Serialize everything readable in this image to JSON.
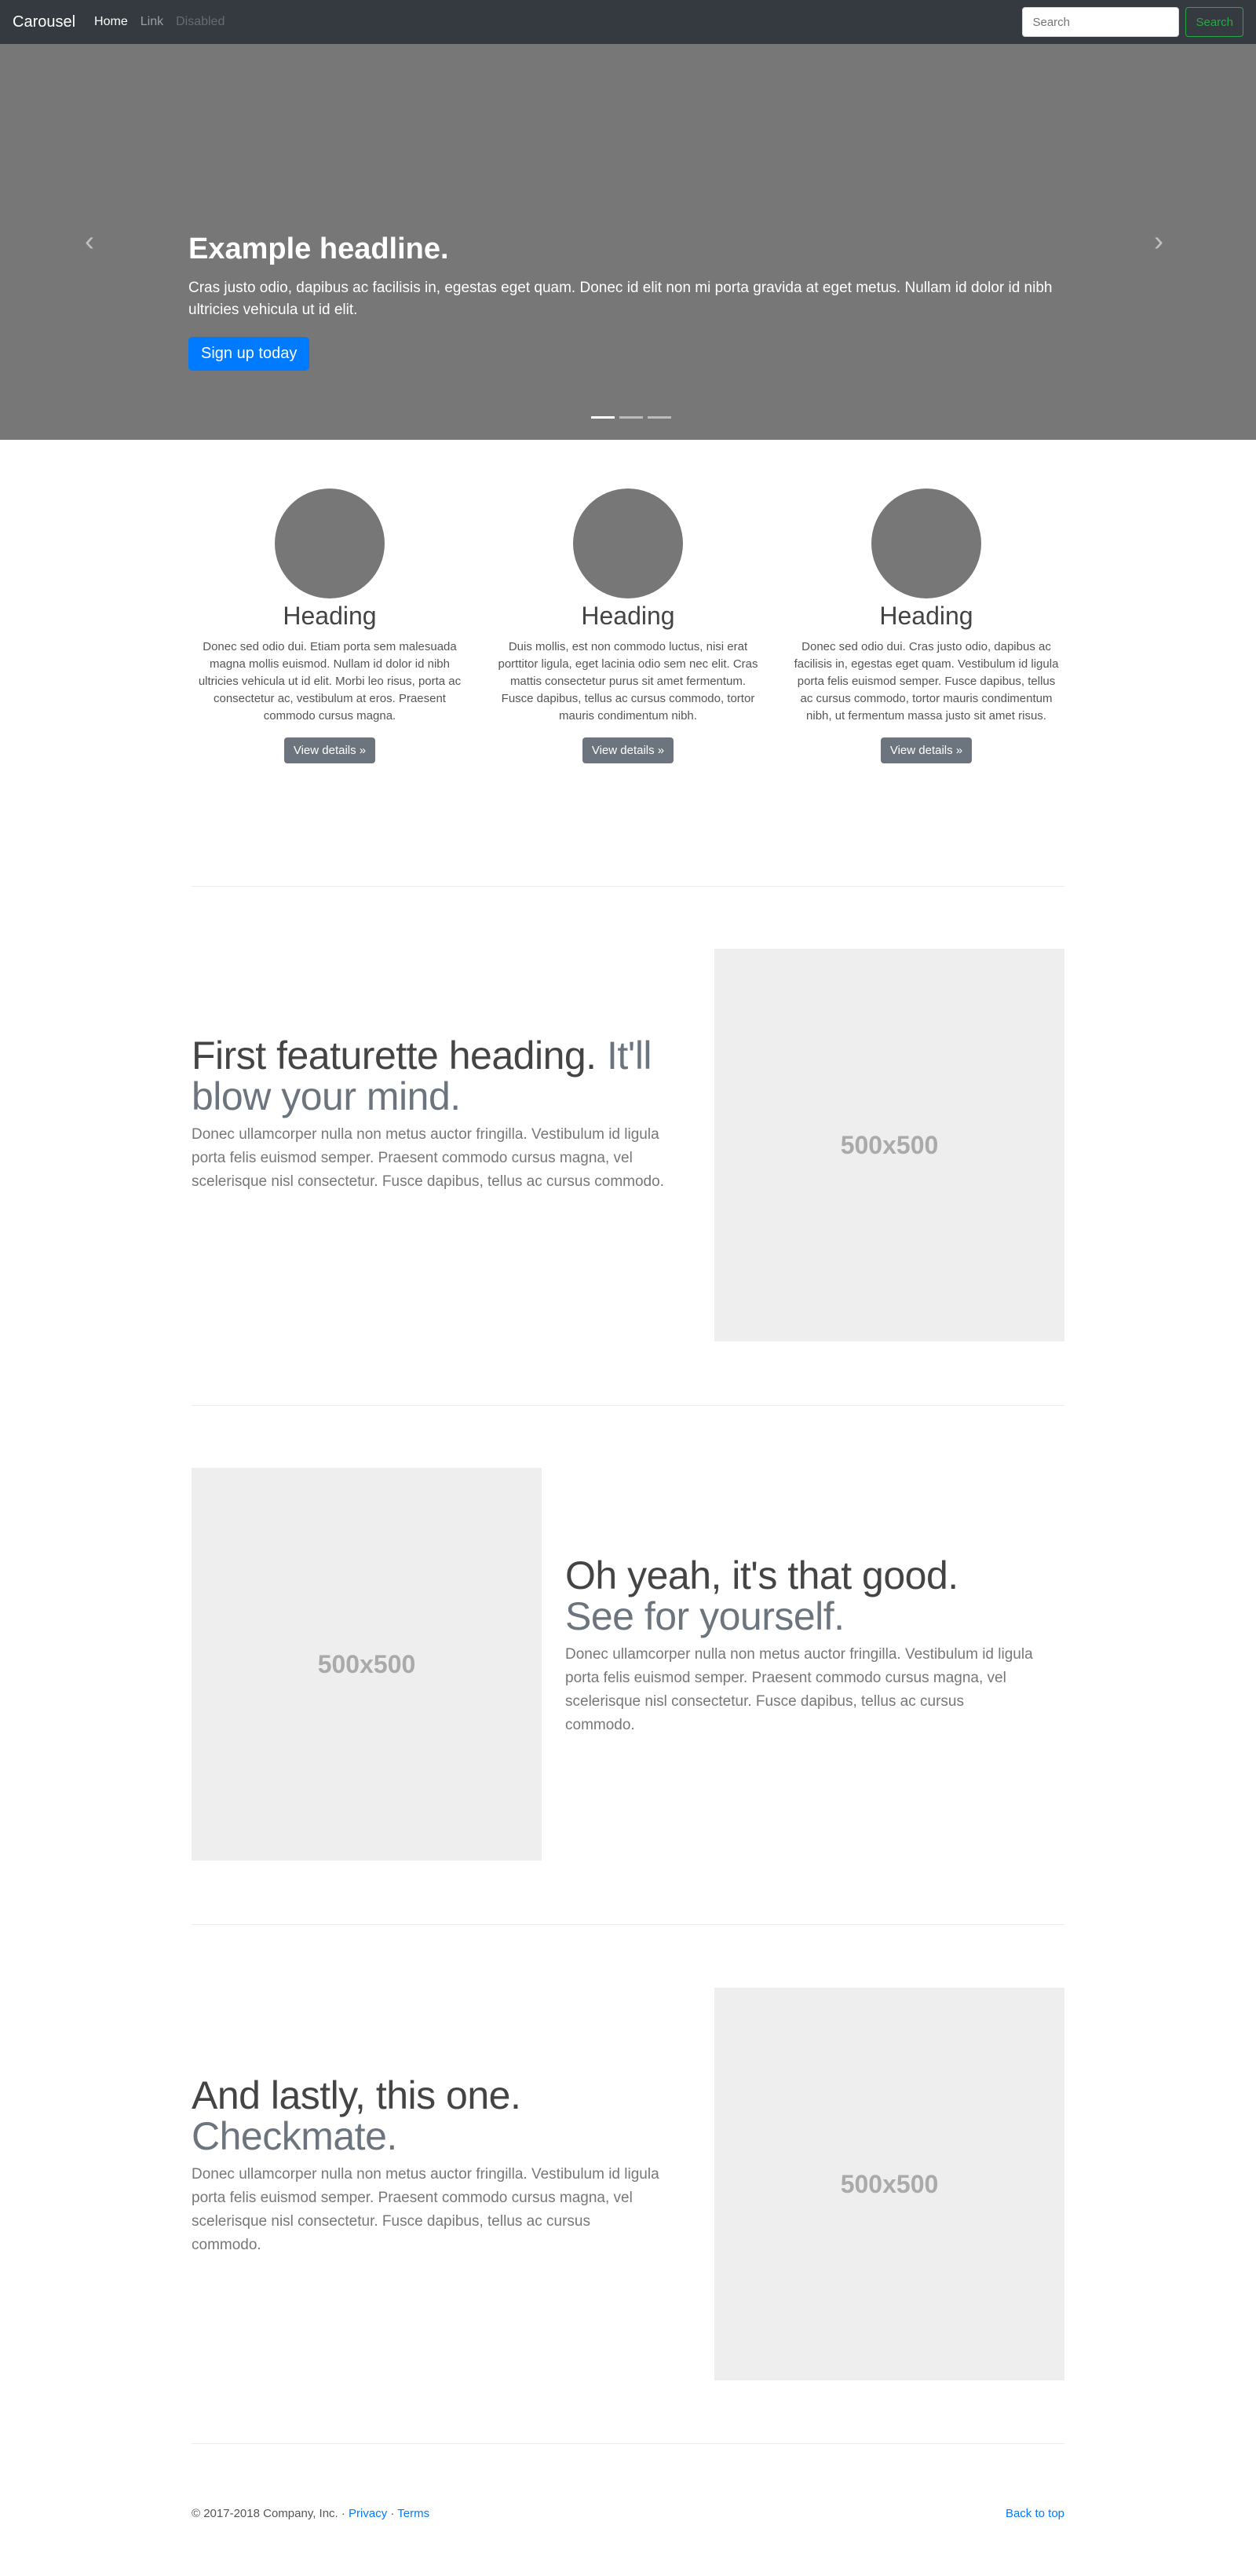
{
  "nav": {
    "brand": "Carousel",
    "links": [
      "Home",
      "Link",
      "Disabled"
    ],
    "search_placeholder": "Search",
    "search_button": "Search"
  },
  "carousel": {
    "headline": "Example headline.",
    "text": "Cras justo odio, dapibus ac facilisis in, egestas eget quam. Donec id elit non mi porta gravida at eget metus. Nullam id dolor id nibh ultricies vehicula ut id elit.",
    "button": "Sign up today",
    "prev_glyph": "‹",
    "next_glyph": "›",
    "slide_count": 3,
    "active_slide": 1
  },
  "columns": [
    {
      "heading": "Heading",
      "text": "Donec sed odio dui. Etiam porta sem malesuada magna mollis euismod. Nullam id dolor id nibh ultricies vehicula ut id elit. Morbi leo risus, porta ac consectetur ac, vestibulum at eros. Praesent commodo cursus magna.",
      "button": "View details »"
    },
    {
      "heading": "Heading",
      "text": "Duis mollis, est non commodo luctus, nisi erat porttitor ligula, eget lacinia odio sem nec elit. Cras mattis consectetur purus sit amet fermentum. Fusce dapibus, tellus ac cursus commodo, tortor mauris condimentum nibh.",
      "button": "View details »"
    },
    {
      "heading": "Heading",
      "text": "Donec sed odio dui. Cras justo odio, dapibus ac facilisis in, egestas eget quam. Vestibulum id ligula porta felis euismod semper. Fusce dapibus, tellus ac cursus commodo, tortor mauris condimentum nibh, ut fermentum massa justo sit amet risus.",
      "button": "View details »"
    }
  ],
  "featurettes": [
    {
      "heading": "First featurette heading.",
      "muted": "It'll blow your mind.",
      "text": "Donec ullamcorper nulla non metus auctor fringilla. Vestibulum id ligula porta felis euismod semper. Praesent commodo cursus magna, vel scelerisque nisl consectetur. Fusce dapibus, tellus ac cursus commodo.",
      "image_label": "500x500"
    },
    {
      "heading": "Oh yeah, it's that good.",
      "muted": "See for yourself.",
      "text": "Donec ullamcorper nulla non metus auctor fringilla. Vestibulum id ligula porta felis euismod semper. Praesent commodo cursus magna, vel scelerisque nisl consectetur. Fusce dapibus, tellus ac cursus commodo.",
      "image_label": "500x500"
    },
    {
      "heading": "And lastly, this one.",
      "muted": "Checkmate.",
      "text": "Donec ullamcorper nulla non metus auctor fringilla. Vestibulum id ligula porta felis euismod semper. Praesent commodo cursus magna, vel scelerisque nisl consectetur. Fusce dapibus, tellus ac cursus commodo.",
      "image_label": "500x500"
    }
  ],
  "footer": {
    "copyright": "© 2017-2018 Company, Inc. · ",
    "privacy": "Privacy",
    "sep": " · ",
    "terms": "Terms",
    "back_to_top": "Back to top"
  }
}
